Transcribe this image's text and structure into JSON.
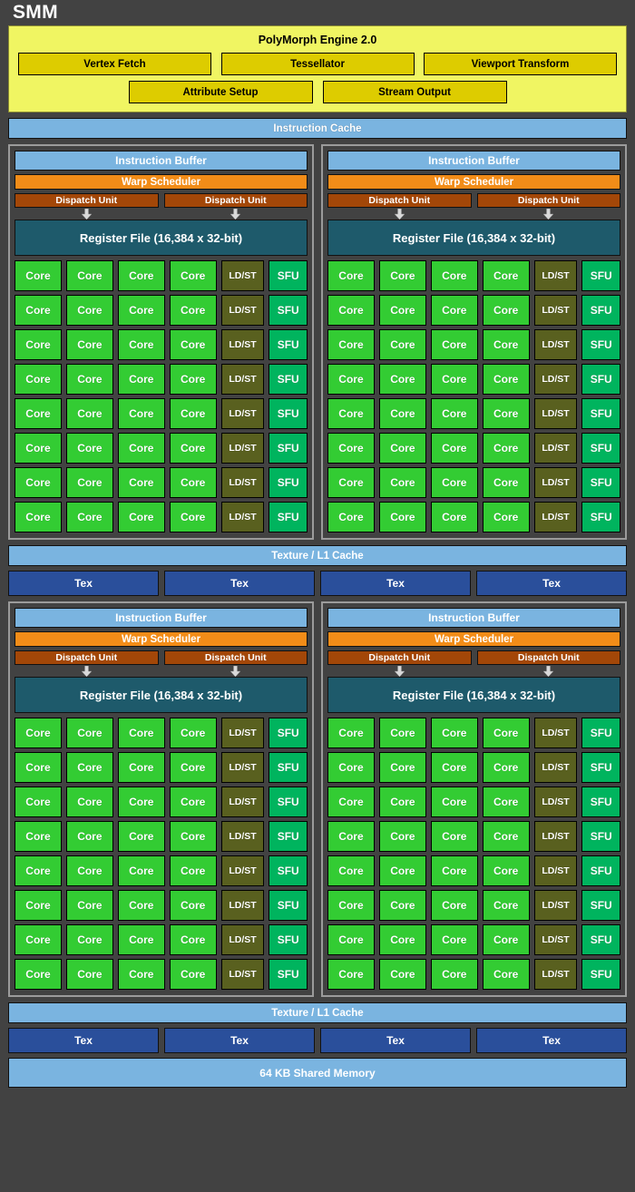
{
  "title": "SMM",
  "colors": {
    "background": "#424242",
    "polymorph_bg": "#f0f562",
    "polymorph_box": "#ddcc00",
    "cache_blue": "#7ab4e0",
    "warp_orange": "#f28c18",
    "dispatch_brown": "#a34708",
    "register_teal": "#1e5a6b",
    "core_green": "#33cc33",
    "ldst_olive": "#59601f",
    "sfu_green": "#00b45e",
    "tex_blue": "#2a4f9b",
    "block_border": "#9b9b9b"
  },
  "polymorph": {
    "title": "PolyMorph Engine 2.0",
    "row1": [
      "Vertex Fetch",
      "Tessellator",
      "Viewport Transform"
    ],
    "row2": [
      "Attribute Setup",
      "Stream Output"
    ]
  },
  "instruction_cache": "Instruction Cache",
  "processing_block": {
    "instruction_buffer": "Instruction Buffer",
    "warp_scheduler": "Warp Scheduler",
    "dispatch_units": [
      "Dispatch Unit",
      "Dispatch Unit"
    ],
    "register_file": "Register File (16,384 x 32-bit)",
    "rows": 8,
    "row_cells": [
      {
        "label": "Core",
        "kind": "core"
      },
      {
        "label": "Core",
        "kind": "core"
      },
      {
        "label": "Core",
        "kind": "core"
      },
      {
        "label": "Core",
        "kind": "core"
      },
      {
        "label": "LD/ST",
        "kind": "ldst"
      },
      {
        "label": "SFU",
        "kind": "sfu"
      }
    ]
  },
  "texture_cache": "Texture / L1 Cache",
  "tex_units": [
    "Tex",
    "Tex",
    "Tex",
    "Tex"
  ],
  "shared_memory": "64 KB Shared Memory",
  "icons": {
    "dispatch_arrow": "down-arrow-icon"
  }
}
